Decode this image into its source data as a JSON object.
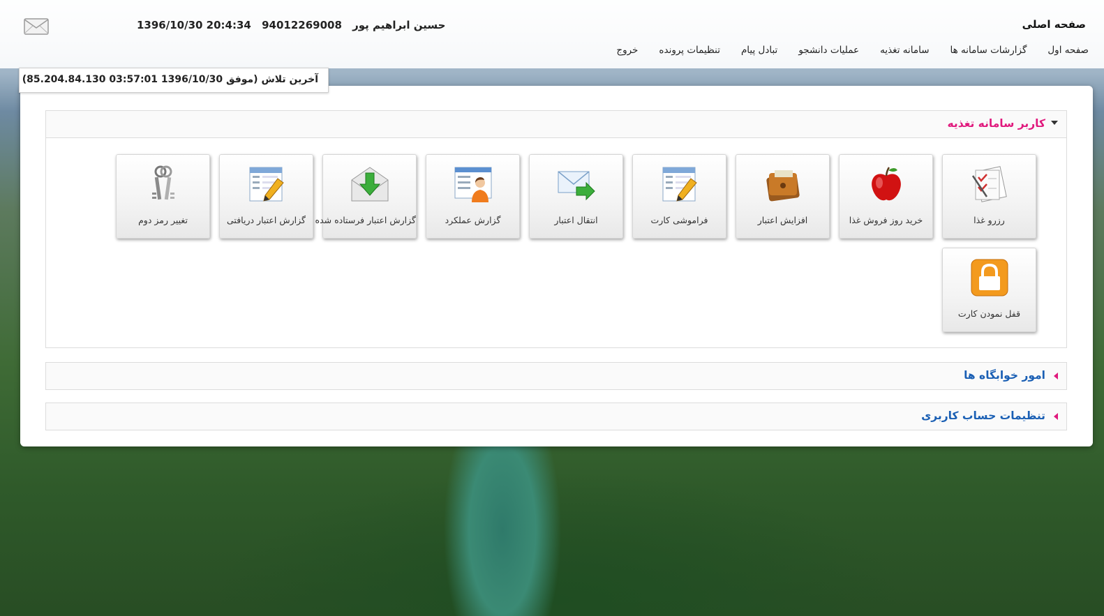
{
  "header": {
    "home_title": "صفحه اصلی",
    "user_name": "حسین  ابراهیم پور",
    "student_id": "94012269008",
    "datetime": "1396/10/30 20:4:34",
    "mail_icon": "envelope-icon"
  },
  "nav": {
    "items": [
      {
        "label": "صفحه اول"
      },
      {
        "label": "گزارشات سامانه ها"
      },
      {
        "label": "سامانه تغذیه"
      },
      {
        "label": "عملیات دانشجو"
      },
      {
        "label": "تبادل پیام"
      },
      {
        "label": "تنظیمات پرونده"
      },
      {
        "label": "خروج"
      }
    ]
  },
  "last_attempt": "آخرین تلاش (موفق 1396/10/30 03:57:01 85.204.84.130)",
  "sections": {
    "nutrition": {
      "title": "کاربر سامانه تغذیه",
      "tiles": [
        {
          "label": "رزرو غذا",
          "icon": "checklist-icon"
        },
        {
          "label": "خرید روز فروش غذا",
          "icon": "apple-icon"
        },
        {
          "label": "افزایش اعتبار",
          "icon": "wallet-icon"
        },
        {
          "label": "فراموشی کارت",
          "icon": "edit-form-icon"
        },
        {
          "label": "انتقال اعتبار",
          "icon": "mail-forward-icon"
        },
        {
          "label": "گزارش عملکرد",
          "icon": "user-report-icon"
        },
        {
          "label": "گزارش اعتبار فرستاده شده",
          "icon": "envelope-download-icon"
        },
        {
          "label": "گزارش اعتبار دریافتی",
          "icon": "edit-form-icon"
        },
        {
          "label": "تغییر رمز دوم",
          "icon": "keys-icon"
        },
        {
          "label": "قفل نمودن کارت",
          "icon": "lock-icon"
        }
      ]
    },
    "dormitory": {
      "title": "امور خوابگاه ها"
    },
    "account": {
      "title": "تنظیمات حساب کاربری"
    }
  },
  "colors": {
    "section_active": "#e0197d",
    "section_link": "#1a5fb4"
  }
}
